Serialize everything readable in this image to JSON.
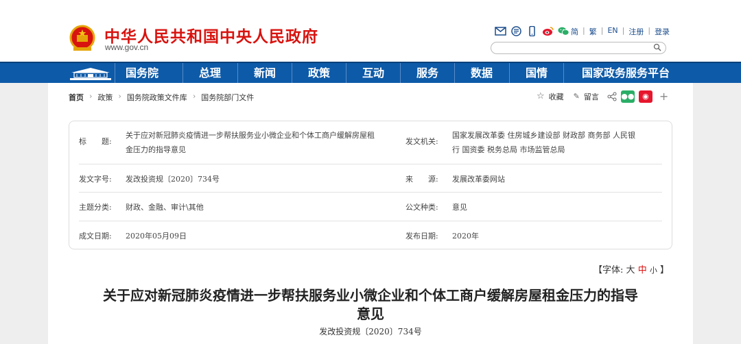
{
  "header": {
    "site_title": "中华人民共和国中央人民政府",
    "site_url": "www.gov.cn",
    "langs": [
      "简",
      "繁",
      "EN",
      "注册",
      "登录"
    ],
    "icons": [
      "mail-icon",
      "rss-icon",
      "mobile-icon",
      "weibo-icon",
      "wechat-icon"
    ],
    "search_placeholder": ""
  },
  "nav": {
    "items": [
      "国务院",
      "总理",
      "新闻",
      "政策",
      "互动",
      "服务",
      "数据",
      "国情",
      "国家政务服务平台"
    ]
  },
  "breadcrumb": {
    "items": [
      "首页",
      "政策",
      "国务院政策文件库",
      "国务院部门文件"
    ]
  },
  "share": {
    "collect": "收藏",
    "comment": "留言"
  },
  "meta": {
    "title_label": "标　　题:",
    "title_value_line1": "关于应对新冠肺炎疫情进一步帮扶服务业小微企业和个体工商户缓解房屋租",
    "title_value_line2": "金压力的指导意见",
    "issuer_label": "发文机关:",
    "issuer_value_line1": "国家发展改革委 住房城乡建设部 财政部 商务部 人民银",
    "issuer_value_line2": "行 国资委 税务总局 市场监管总局",
    "docno_label": "发文字号:",
    "docno_value": "发改投资规〔2020〕734号",
    "source_label": "来　　源:",
    "source_value": "发展改革委网站",
    "topic_label": "主题分类:",
    "topic_value": "财政、金融、审计\\其他",
    "type_label": "公文种类:",
    "type_value": "意见",
    "date_label": "成文日期:",
    "date_value": "2020年05月09日",
    "pub_label": "发布日期:",
    "pub_value": "2020年"
  },
  "fontsize": {
    "open": "【字体:",
    "large": "大",
    "medium": "中",
    "small": "小",
    "close": "】"
  },
  "document": {
    "title_line1": "关于应对新冠肺炎疫情进一步帮扶服务业小微企业和个体工商户缓解房屋租金压力的指导",
    "title_line2": "意见",
    "number": "发改投资规〔2020〕734号"
  },
  "colors": {
    "brand_red": "#d8130f",
    "nav_blue": "#0d5aa8",
    "link_blue": "#1a4c8c"
  }
}
